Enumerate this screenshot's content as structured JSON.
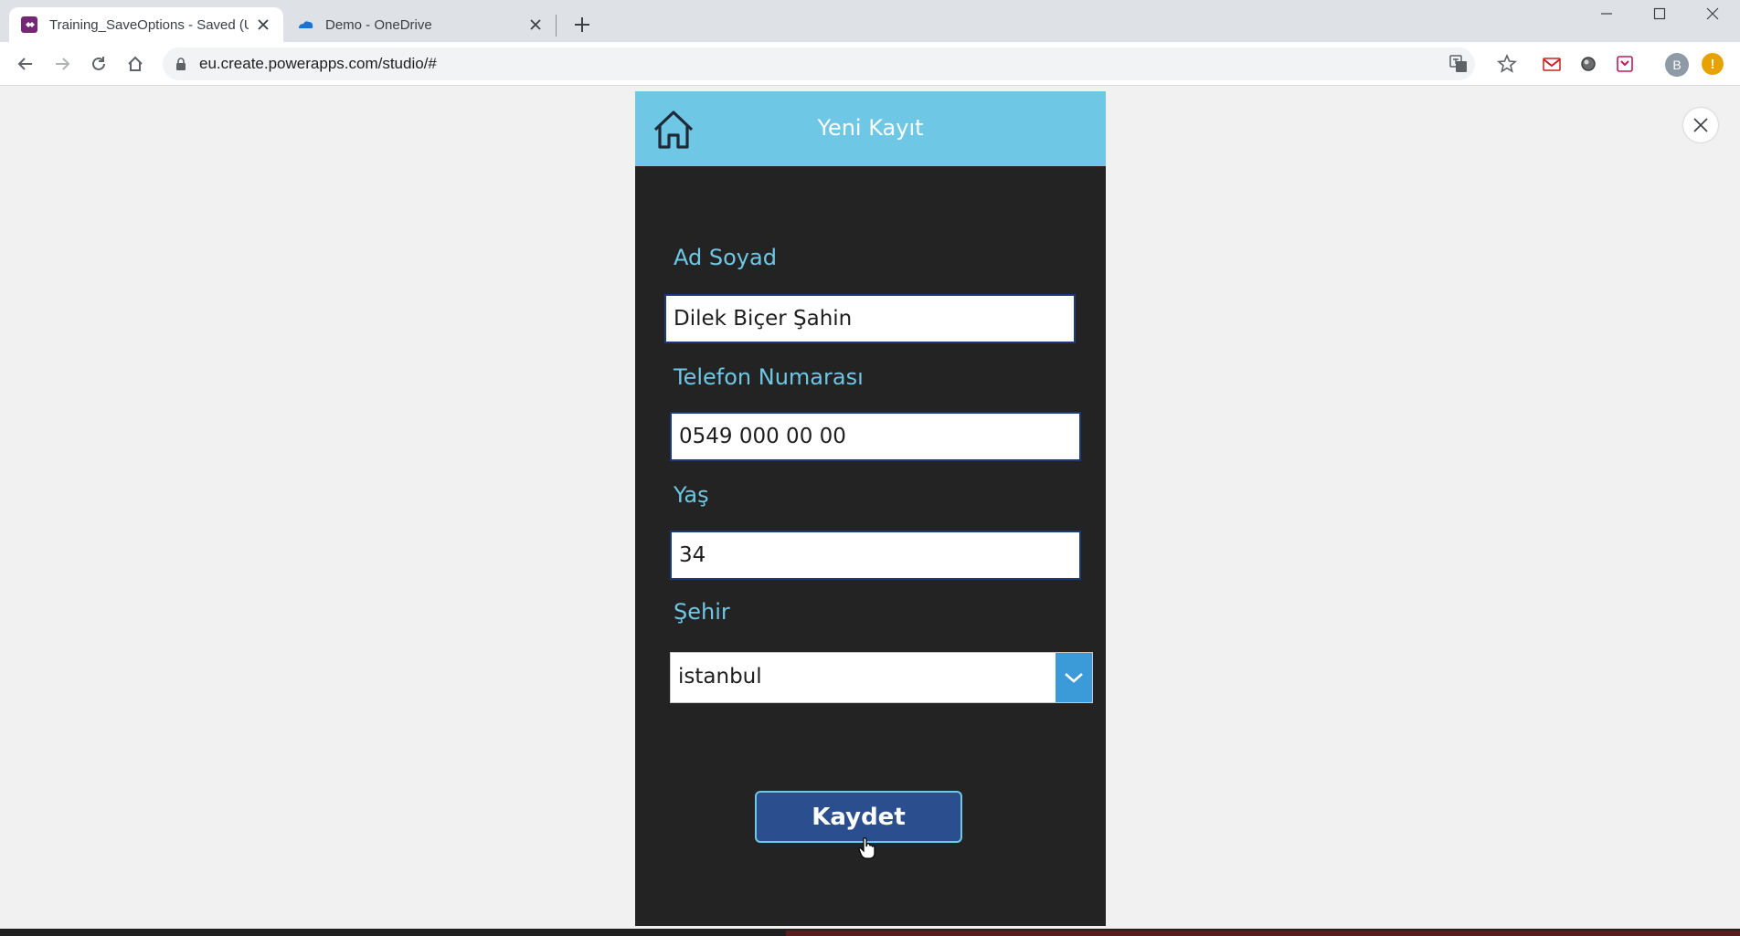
{
  "browser": {
    "tabs": [
      {
        "title": "Training_SaveOptions - Saved (U",
        "active": true
      },
      {
        "title": "Demo - OneDrive",
        "active": false
      }
    ],
    "url": "eu.create.powerapps.com/studio/#",
    "profile_initial": "B",
    "update_badge": "!"
  },
  "app": {
    "header_title": "Yeni Kayıt",
    "fields": {
      "name_label": "Ad Soyad",
      "name_value": "Dilek Biçer Şahin",
      "phone_label": "Telefon Numarası",
      "phone_value": "0549 000 00 00",
      "age_label": "Yaş",
      "age_value": "34",
      "city_label": "Şehir",
      "city_value": "istanbul"
    },
    "save_label": "Kaydet"
  },
  "colors": {
    "header": "#6ec7e4",
    "canvas": "#232323",
    "label": "#6ec7e4",
    "button": "#2b4f8e",
    "dropdown_arrow": "#3b9ad8"
  }
}
